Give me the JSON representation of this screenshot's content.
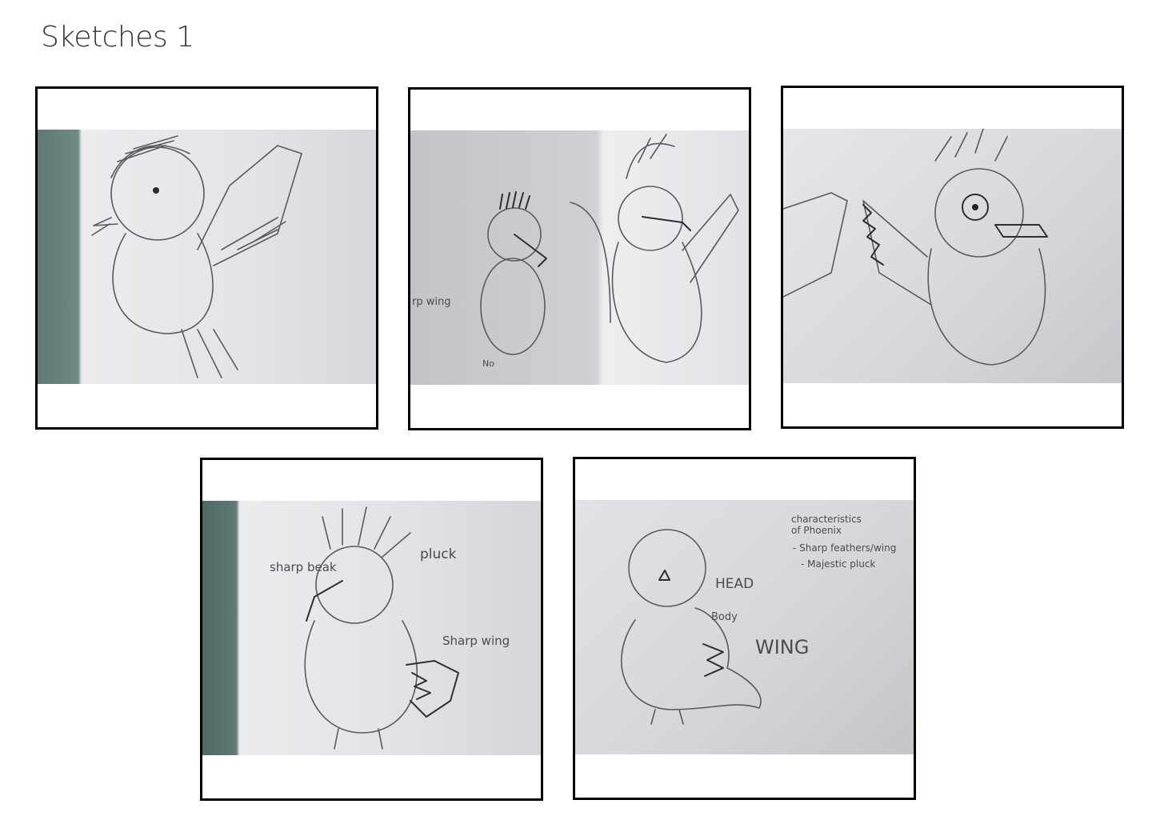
{
  "page": {
    "title": "Sketches 1"
  },
  "sketches": [
    {
      "annotations": []
    },
    {
      "annotations": [
        "rp wing",
        "No"
      ]
    },
    {
      "annotations": []
    },
    {
      "annotations": [
        "sharp beak",
        "pluck",
        "Sharp wing"
      ]
    },
    {
      "annotations": [
        "characteristics",
        "of Phoenix",
        "- Sharp feathers/wing",
        "- Majestic pluck",
        "HEAD",
        "Body",
        "WING"
      ]
    }
  ]
}
